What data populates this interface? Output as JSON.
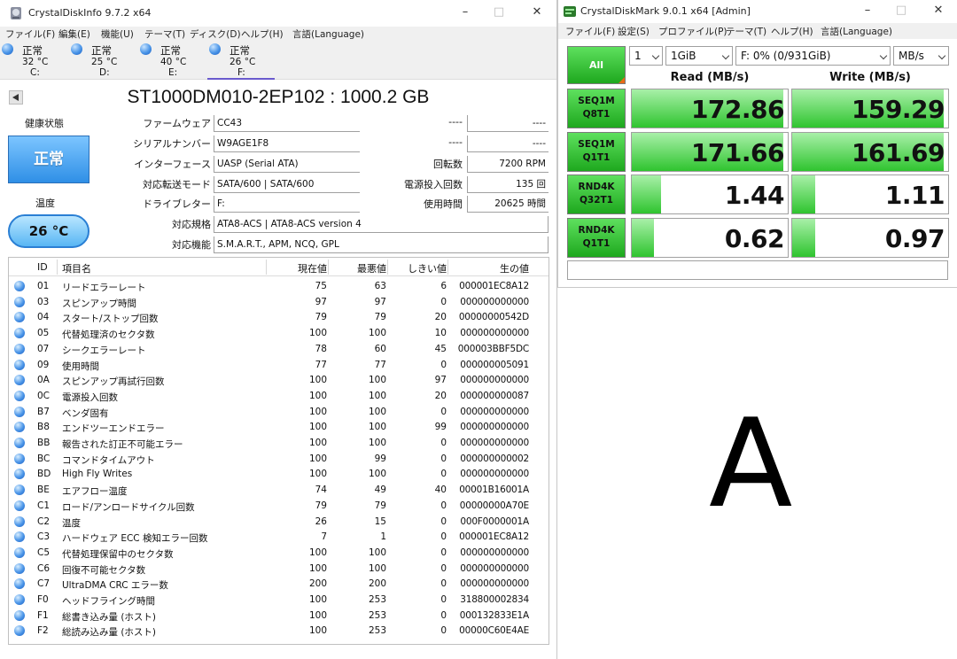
{
  "cdi": {
    "title": "CrystalDiskInfo 9.7.2 x64",
    "menu": [
      "ファイル(F)",
      "編集(E)",
      "機能(U)",
      "テーマ(T)",
      "ディスク(D)",
      "ヘルプ(H)",
      "言語(Language)"
    ],
    "drives": [
      {
        "status": "正常",
        "temp": "32 °C",
        "letter": "C:"
      },
      {
        "status": "正常",
        "temp": "25 °C",
        "letter": "D:"
      },
      {
        "status": "正常",
        "temp": "40 °C",
        "letter": "E:"
      },
      {
        "status": "正常",
        "temp": "26 °C",
        "letter": "F:"
      }
    ],
    "model": "ST1000DM010-2EP102 : 1000.2 GB",
    "health_label": "健康状態",
    "health_value": "正常",
    "temp_label": "温度",
    "temp_value": "26 °C",
    "fields": {
      "firmware_label": "ファームウェア",
      "firmware": "CC43",
      "serial_label": "シリアルナンバー",
      "serial": "W9AGE1F8",
      "interface_label": "インターフェース",
      "interface": "UASP (Serial ATA)",
      "transfer_label": "対応転送モード",
      "transfer": "SATA/600 | SATA/600",
      "driveletter_label": "ドライブレター",
      "driveletter": "F:",
      "standard_label": "対応規格",
      "standard": "ATA8-ACS | ATA8-ACS version 4",
      "features_label": "対応機能",
      "features": "S.M.A.R.T., APM, NCQ, GPL"
    },
    "right_fields": {
      "blank1_label": "----",
      "blank1": "----",
      "blank2_label": "----",
      "blank2": "----",
      "rpm_label": "回転数",
      "rpm": "7200 RPM",
      "poweron_count_label": "電源投入回数",
      "poweron_count": "135 回",
      "poweron_hours_label": "使用時間",
      "poweron_hours": "20625 時間"
    },
    "smart_headers": {
      "id": "ID",
      "name": "項目名",
      "current": "現在値",
      "worst": "最悪値",
      "threshold": "しきい値",
      "raw": "生の値"
    },
    "smart_rows": [
      {
        "id": "01",
        "name": "リードエラーレート",
        "cur": "75",
        "wor": "63",
        "thr": "6",
        "raw": "000001EC8A12"
      },
      {
        "id": "03",
        "name": "スピンアップ時間",
        "cur": "97",
        "wor": "97",
        "thr": "0",
        "raw": "000000000000"
      },
      {
        "id": "04",
        "name": "スタート/ストップ回数",
        "cur": "79",
        "wor": "79",
        "thr": "20",
        "raw": "00000000542D"
      },
      {
        "id": "05",
        "name": "代替処理済のセクタ数",
        "cur": "100",
        "wor": "100",
        "thr": "10",
        "raw": "000000000000"
      },
      {
        "id": "07",
        "name": "シークエラーレート",
        "cur": "78",
        "wor": "60",
        "thr": "45",
        "raw": "000003BBF5DC"
      },
      {
        "id": "09",
        "name": "使用時間",
        "cur": "77",
        "wor": "77",
        "thr": "0",
        "raw": "000000005091"
      },
      {
        "id": "0A",
        "name": "スピンアップ再試行回数",
        "cur": "100",
        "wor": "100",
        "thr": "97",
        "raw": "000000000000"
      },
      {
        "id": "0C",
        "name": "電源投入回数",
        "cur": "100",
        "wor": "100",
        "thr": "20",
        "raw": "000000000087"
      },
      {
        "id": "B7",
        "name": "ベンダ固有",
        "cur": "100",
        "wor": "100",
        "thr": "0",
        "raw": "000000000000"
      },
      {
        "id": "B8",
        "name": "エンドツーエンドエラー",
        "cur": "100",
        "wor": "100",
        "thr": "99",
        "raw": "000000000000"
      },
      {
        "id": "BB",
        "name": "報告された訂正不可能エラー",
        "cur": "100",
        "wor": "100",
        "thr": "0",
        "raw": "000000000000"
      },
      {
        "id": "BC",
        "name": "コマンドタイムアウト",
        "cur": "100",
        "wor": "99",
        "thr": "0",
        "raw": "000000000002"
      },
      {
        "id": "BD",
        "name": "High Fly Writes",
        "cur": "100",
        "wor": "100",
        "thr": "0",
        "raw": "000000000000"
      },
      {
        "id": "BE",
        "name": "エアフロー温度",
        "cur": "74",
        "wor": "49",
        "thr": "40",
        "raw": "00001B16001A"
      },
      {
        "id": "C1",
        "name": "ロード/アンロードサイクル回数",
        "cur": "79",
        "wor": "79",
        "thr": "0",
        "raw": "00000000A70E"
      },
      {
        "id": "C2",
        "name": "温度",
        "cur": "26",
        "wor": "15",
        "thr": "0",
        "raw": "000F0000001A"
      },
      {
        "id": "C3",
        "name": "ハードウェア ECC 検知エラー回数",
        "cur": "7",
        "wor": "1",
        "thr": "0",
        "raw": "000001EC8A12"
      },
      {
        "id": "C5",
        "name": "代替処理保留中のセクタ数",
        "cur": "100",
        "wor": "100",
        "thr": "0",
        "raw": "000000000000"
      },
      {
        "id": "C6",
        "name": "回復不可能セクタ数",
        "cur": "100",
        "wor": "100",
        "thr": "0",
        "raw": "000000000000"
      },
      {
        "id": "C7",
        "name": "UltraDMA CRC エラー数",
        "cur": "200",
        "wor": "200",
        "thr": "0",
        "raw": "000000000000"
      },
      {
        "id": "F0",
        "name": "ヘッドフライング時間",
        "cur": "100",
        "wor": "253",
        "thr": "0",
        "raw": "318800002834"
      },
      {
        "id": "F1",
        "name": "総書き込み量 (ホスト)",
        "cur": "100",
        "wor": "253",
        "thr": "0",
        "raw": "000132833E1A"
      },
      {
        "id": "F2",
        "name": "総読み込み量 (ホスト)",
        "cur": "100",
        "wor": "253",
        "thr": "0",
        "raw": "00000C60E4AE"
      }
    ],
    "colors": {
      "health": "#2f8fe6",
      "selected_tab": "#6a5acd"
    }
  },
  "cdm": {
    "title": "CrystalDiskMark 9.0.1 x64 [Admin]",
    "menu": [
      "ファイル(F)",
      "設定(S)",
      "プロファイル(P)",
      "テーマ(T)",
      "ヘルプ(H)",
      "言語(Language)"
    ],
    "all_label": "All",
    "count": "1",
    "size": "1GiB",
    "drive": "F: 0% (0/931GiB)",
    "unit": "MB/s",
    "read_header": "Read (MB/s)",
    "write_header": "Write (MB/s)",
    "tests": [
      {
        "line1": "SEQ1M",
        "line2": "Q8T1",
        "read": "172.86",
        "write": "159.29",
        "read_fill": 0.97,
        "write_fill": 0.97
      },
      {
        "line1": "SEQ1M",
        "line2": "Q1T1",
        "read": "171.66",
        "write": "161.69",
        "read_fill": 0.97,
        "write_fill": 0.97
      },
      {
        "line1": "RND4K",
        "line2": "Q32T1",
        "read": "1.44",
        "write": "1.11",
        "read_fill": 0.19,
        "write_fill": 0.15
      },
      {
        "line1": "RND4K",
        "line2": "Q1T1",
        "read": "0.62",
        "write": "0.97",
        "read_fill": 0.14,
        "write_fill": 0.15
      }
    ],
    "colors": {
      "button_green": "#1ea81e",
      "bar_green": "#2fc42f",
      "corner_orange": "#e86a18"
    }
  },
  "overlay_letter": "A"
}
